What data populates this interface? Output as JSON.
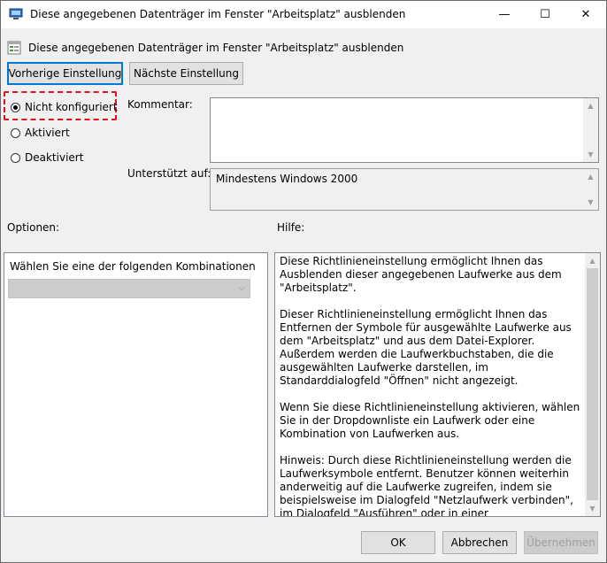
{
  "window": {
    "title": "Diese angegebenen Datenträger im Fenster \"Arbeitsplatz\" ausblenden",
    "minimize": "—",
    "maximize": "☐",
    "close": "✕"
  },
  "setting": {
    "title": "Diese angegebenen Datenträger im Fenster \"Arbeitsplatz\" ausblenden",
    "icon": "policy-setting-icon"
  },
  "nav": {
    "prev_label": "Vorherige Einstellung",
    "next_label": "Nächste Einstellung"
  },
  "state": {
    "options": [
      {
        "label": "Nicht konfiguriert",
        "selected": true
      },
      {
        "label": "Aktiviert",
        "selected": false
      },
      {
        "label": "Deaktiviert",
        "selected": false
      }
    ]
  },
  "comment": {
    "label": "Kommentar:",
    "value": ""
  },
  "supported": {
    "label": "Unterstützt auf:",
    "value": "Mindestens Windows 2000"
  },
  "options_panel": {
    "label": "Optionen:",
    "combo_label": "Wählen Sie eine der folgenden Kombinationen",
    "combo_value": ""
  },
  "help": {
    "label": "Hilfe:",
    "paragraphs": [
      "Diese Richtlinieneinstellung ermöglicht Ihnen das Ausblenden dieser angegebenen Laufwerke aus dem \"Arbeitsplatz\".",
      "Dieser Richtlinieneinstellung ermöglicht Ihnen das Entfernen der Symbole für ausgewählte Laufwerke aus dem \"Arbeitsplatz\" und aus dem Datei-Explorer. Außerdem werden die Laufwerkbuchstaben, die die ausgewählten Laufwerke darstellen, im Standarddialogfeld \"Öffnen\" nicht angezeigt.",
      "Wenn Sie diese Richtlinieneinstellung aktivieren, wählen Sie in der Dropdownliste ein Laufwerk oder eine Kombination von Laufwerken aus.",
      "Hinweis: Durch diese Richtlinieneinstellung werden die Laufwerksymbole entfernt. Benutzer können weiterhin anderweitig auf die Laufwerke zugreifen, indem sie beispielsweise im Dialogfeld \"Netzlaufwerk verbinden\", im Dialogfeld \"Ausführen\" oder in einer Eingabeaufforderung den Pfad zu einem Verzeichnis auf dem Laufwerk eingeben."
    ]
  },
  "footer": {
    "ok_label": "OK",
    "cancel_label": "Abbrechen",
    "apply_label": "Übernehmen"
  }
}
